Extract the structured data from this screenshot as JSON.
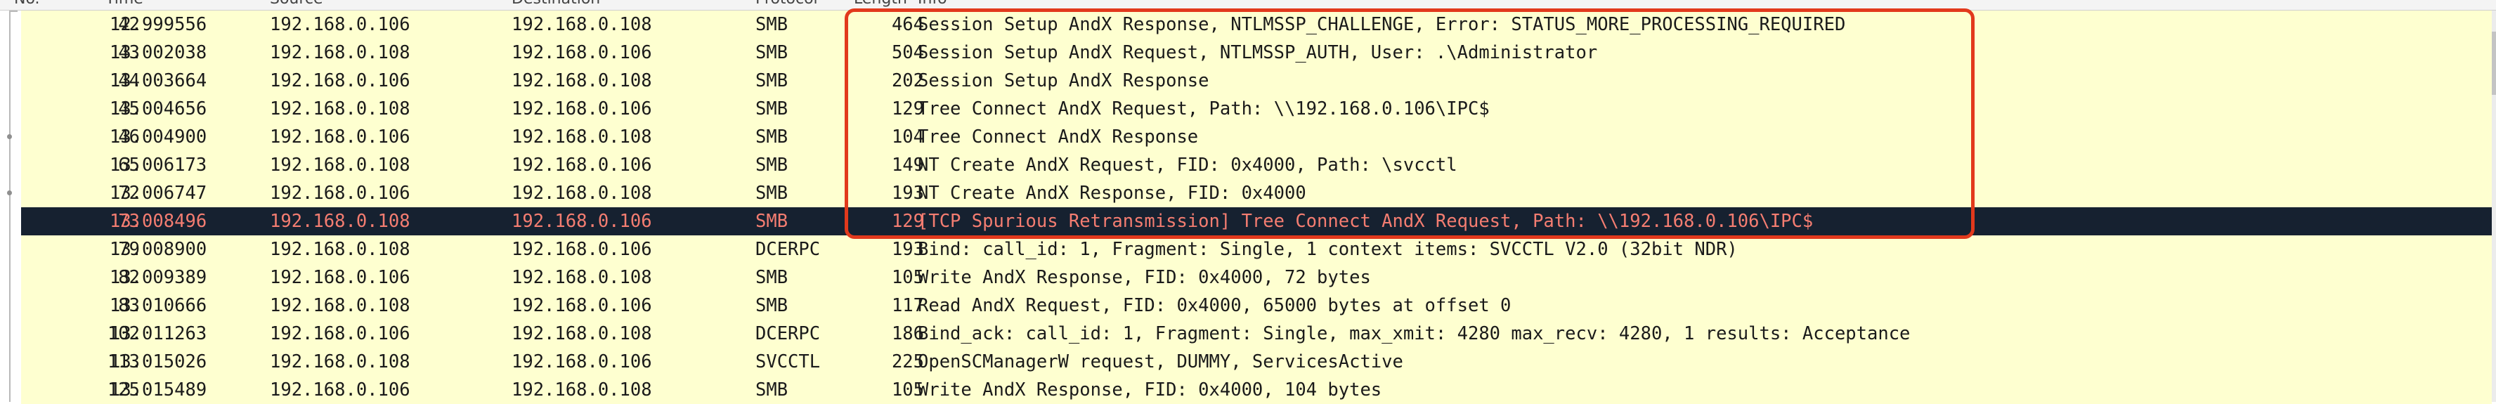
{
  "header": {
    "columns": [
      "No.",
      "Time",
      "Source",
      "Destination",
      "Protocol",
      "Length",
      "Info"
    ]
  },
  "packets": [
    {
      "no": "42",
      "time": "12.999556",
      "src": "192.168.0.106",
      "dst": "192.168.0.108",
      "proto": "SMB",
      "len": "464",
      "info": "Session Setup AndX Response, NTLMSSP_CHALLENGE, Error: STATUS_MORE_PROCESSING_REQUIRED"
    },
    {
      "no": "43",
      "time": "13.002038",
      "src": "192.168.0.108",
      "dst": "192.168.0.106",
      "proto": "SMB",
      "len": "504",
      "info": "Session Setup AndX Request, NTLMSSP_AUTH, User: .\\Administrator"
    },
    {
      "no": "44",
      "time": "13.003664",
      "src": "192.168.0.106",
      "dst": "192.168.0.108",
      "proto": "SMB",
      "len": "202",
      "info": "Session Setup AndX Response"
    },
    {
      "no": "45",
      "time": "13.004656",
      "src": "192.168.0.108",
      "dst": "192.168.0.106",
      "proto": "SMB",
      "len": "129",
      "info": "Tree Connect AndX Request, Path: \\\\192.168.0.106\\IPC$"
    },
    {
      "no": "46",
      "time": "13.004900",
      "src": "192.168.0.106",
      "dst": "192.168.0.108",
      "proto": "SMB",
      "len": "104",
      "info": "Tree Connect AndX Response"
    },
    {
      "no": "65",
      "time": "13.006173",
      "src": "192.168.0.108",
      "dst": "192.168.0.106",
      "proto": "SMB",
      "len": "149",
      "info": "NT Create AndX Request, FID: 0x4000, Path: \\svcctl"
    },
    {
      "no": "72",
      "time": "13.006747",
      "src": "192.168.0.106",
      "dst": "192.168.0.108",
      "proto": "SMB",
      "len": "193",
      "info": "NT Create AndX Response, FID: 0x4000"
    },
    {
      "no": "73",
      "time": "13.008496",
      "src": "192.168.0.108",
      "dst": "192.168.0.106",
      "proto": "SMB",
      "len": "129",
      "info": "[TCP Spurious Retransmission] Tree Connect AndX Request, Path: \\\\192.168.0.106\\IPC$"
    },
    {
      "no": "79",
      "time": "13.008900",
      "src": "192.168.0.108",
      "dst": "192.168.0.106",
      "proto": "DCERPC",
      "len": "193",
      "info": "Bind: call_id: 1, Fragment: Single, 1 context items: SVCCTL V2.0 (32bit NDR)"
    },
    {
      "no": "82",
      "time": "13.009389",
      "src": "192.168.0.106",
      "dst": "192.168.0.108",
      "proto": "SMB",
      "len": "105",
      "info": "Write AndX Response, FID: 0x4000, 72 bytes"
    },
    {
      "no": "83",
      "time": "13.010666",
      "src": "192.168.0.108",
      "dst": "192.168.0.106",
      "proto": "SMB",
      "len": "117",
      "info": "Read AndX Request, FID: 0x4000, 65000 bytes at offset 0"
    },
    {
      "no": "102",
      "time": "13.011263",
      "src": "192.168.0.106",
      "dst": "192.168.0.108",
      "proto": "DCERPC",
      "len": "186",
      "info": "Bind_ack: call_id: 1, Fragment: Single, max_xmit: 4280 max_recv: 4280, 1 results: Acceptance"
    },
    {
      "no": "113",
      "time": "13.015026",
      "src": "192.168.0.108",
      "dst": "192.168.0.106",
      "proto": "SVCCTL",
      "len": "225",
      "info": "OpenSCManagerW request, DUMMY, ServicesActive"
    },
    {
      "no": "125",
      "time": "13.015489",
      "src": "192.168.0.106",
      "dst": "192.168.0.108",
      "proto": "SMB",
      "len": "105",
      "info": "Write AndX Response, FID: 0x4000, 104 bytes"
    }
  ],
  "selected_packet": "73",
  "colors": {
    "row_background": "#feffd0",
    "selected_background": "#162130",
    "selected_text": "#f47d71",
    "annotation_box": "#e2391c"
  }
}
